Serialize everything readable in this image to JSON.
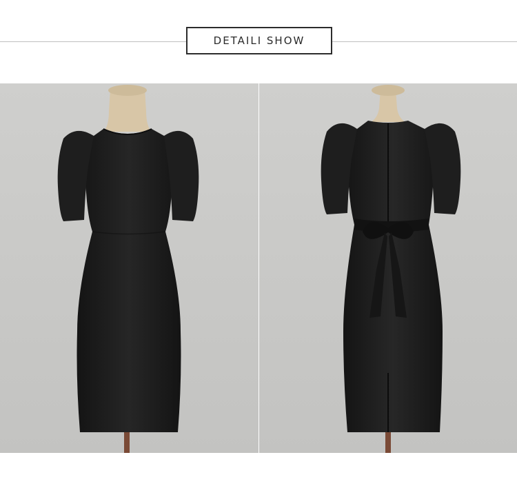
{
  "header": {
    "title": "DETAILI SHOW"
  },
  "colors": {
    "backdrop": "#c9c9c7",
    "dress": "#1c1c1c",
    "mannequin": "#d9c7a8",
    "rule": "#bfbfbf"
  },
  "photos": [
    {
      "view": "front"
    },
    {
      "view": "back"
    }
  ]
}
